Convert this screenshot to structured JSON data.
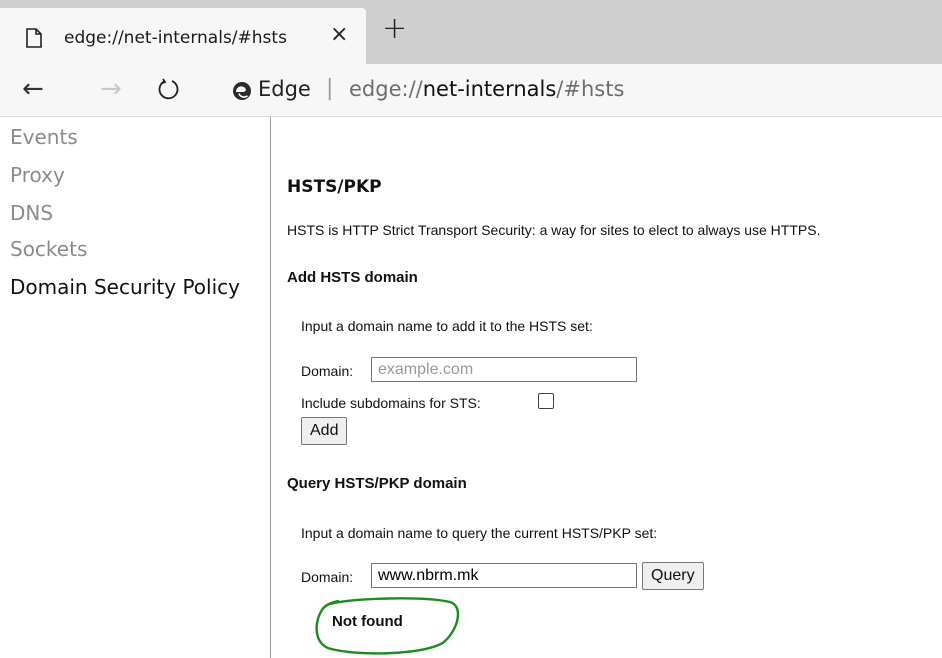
{
  "tab": {
    "title": "edge://net-internals/#hsts",
    "close": "×",
    "new": "+"
  },
  "nav": {
    "back": "←",
    "forward": "→"
  },
  "address": {
    "brand": "Edge",
    "separator": "|",
    "url_scheme": "edge://",
    "url_host": "net-internals",
    "url_path": "/#hsts"
  },
  "sidebar": {
    "items": [
      {
        "label": "Events"
      },
      {
        "label": "Proxy"
      },
      {
        "label": "DNS"
      },
      {
        "label": "Sockets"
      },
      {
        "label": "Domain Security Policy"
      }
    ]
  },
  "main": {
    "title": "HSTS/PKP",
    "description": "HSTS is HTTP Strict Transport Security: a way for sites to elect to always use HTTPS.",
    "add": {
      "heading": "Add HSTS domain",
      "prompt": "Input a domain name to add it to the HSTS set:",
      "domain_label": "Domain:",
      "domain_placeholder": "example.com",
      "subdomains_label": "Include subdomains for STS:",
      "button": "Add"
    },
    "query": {
      "heading": "Query HSTS/PKP domain",
      "prompt": "Input a domain name to query the current HSTS/PKP set:",
      "domain_label": "Domain:",
      "domain_value": "www.nbrm.mk",
      "button": "Query",
      "result": "Not found"
    }
  }
}
